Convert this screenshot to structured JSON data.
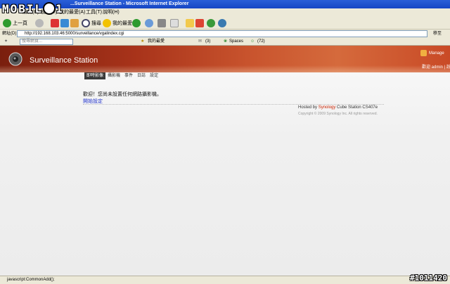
{
  "browser": {
    "window_title": "...Surveillance Station - Microsoft Internet Explorer",
    "menu": [
      "檔案(F)",
      "編輯(E)",
      "檢視(V)",
      "我的最愛(A)",
      "工具(T)",
      "說明(H)"
    ],
    "toolbar": {
      "back_label": "上一頁",
      "search_label": "搜尋",
      "favorites_label": "我的最愛"
    },
    "address": {
      "label": "網址(D)",
      "url": "http://192.168.103.46:5000/surveillance/vgalindex.cgi",
      "go_label": "移至"
    },
    "links": {
      "search_placeholder": "搜尋網頁...",
      "favorites_label": "我的最愛",
      "mail_count": "(3)",
      "spaces_label": "Spaces",
      "msn_count": "(72)"
    },
    "status_text": "javascript:CommonAdd();"
  },
  "app": {
    "title": "Surveillance Station",
    "manage_label": "Manage",
    "user_line": "歡迎 admin | 說",
    "tabs": [
      "即時影像",
      "攝影機",
      "事件",
      "日誌",
      "設定"
    ],
    "active_tab": 0,
    "welcome_message": "歡迎！您尚未設置任何網路攝影機。",
    "start_link": "開始設定",
    "hosted_prefix": "Hosted by",
    "hosted_brand": "Synology",
    "hosted_suffix": "Cube Station CS407e",
    "copyright": "Copyright © 2009 Synology Inc. All rights reserved."
  },
  "overlay": {
    "logo_text": "MOBILE01",
    "watermark": "#1011420"
  },
  "colors": {
    "banner_dark": "#7a1f0e",
    "banner_light": "#d56a3c",
    "link_blue": "#2233cc",
    "synology_red": "#cc2200"
  }
}
